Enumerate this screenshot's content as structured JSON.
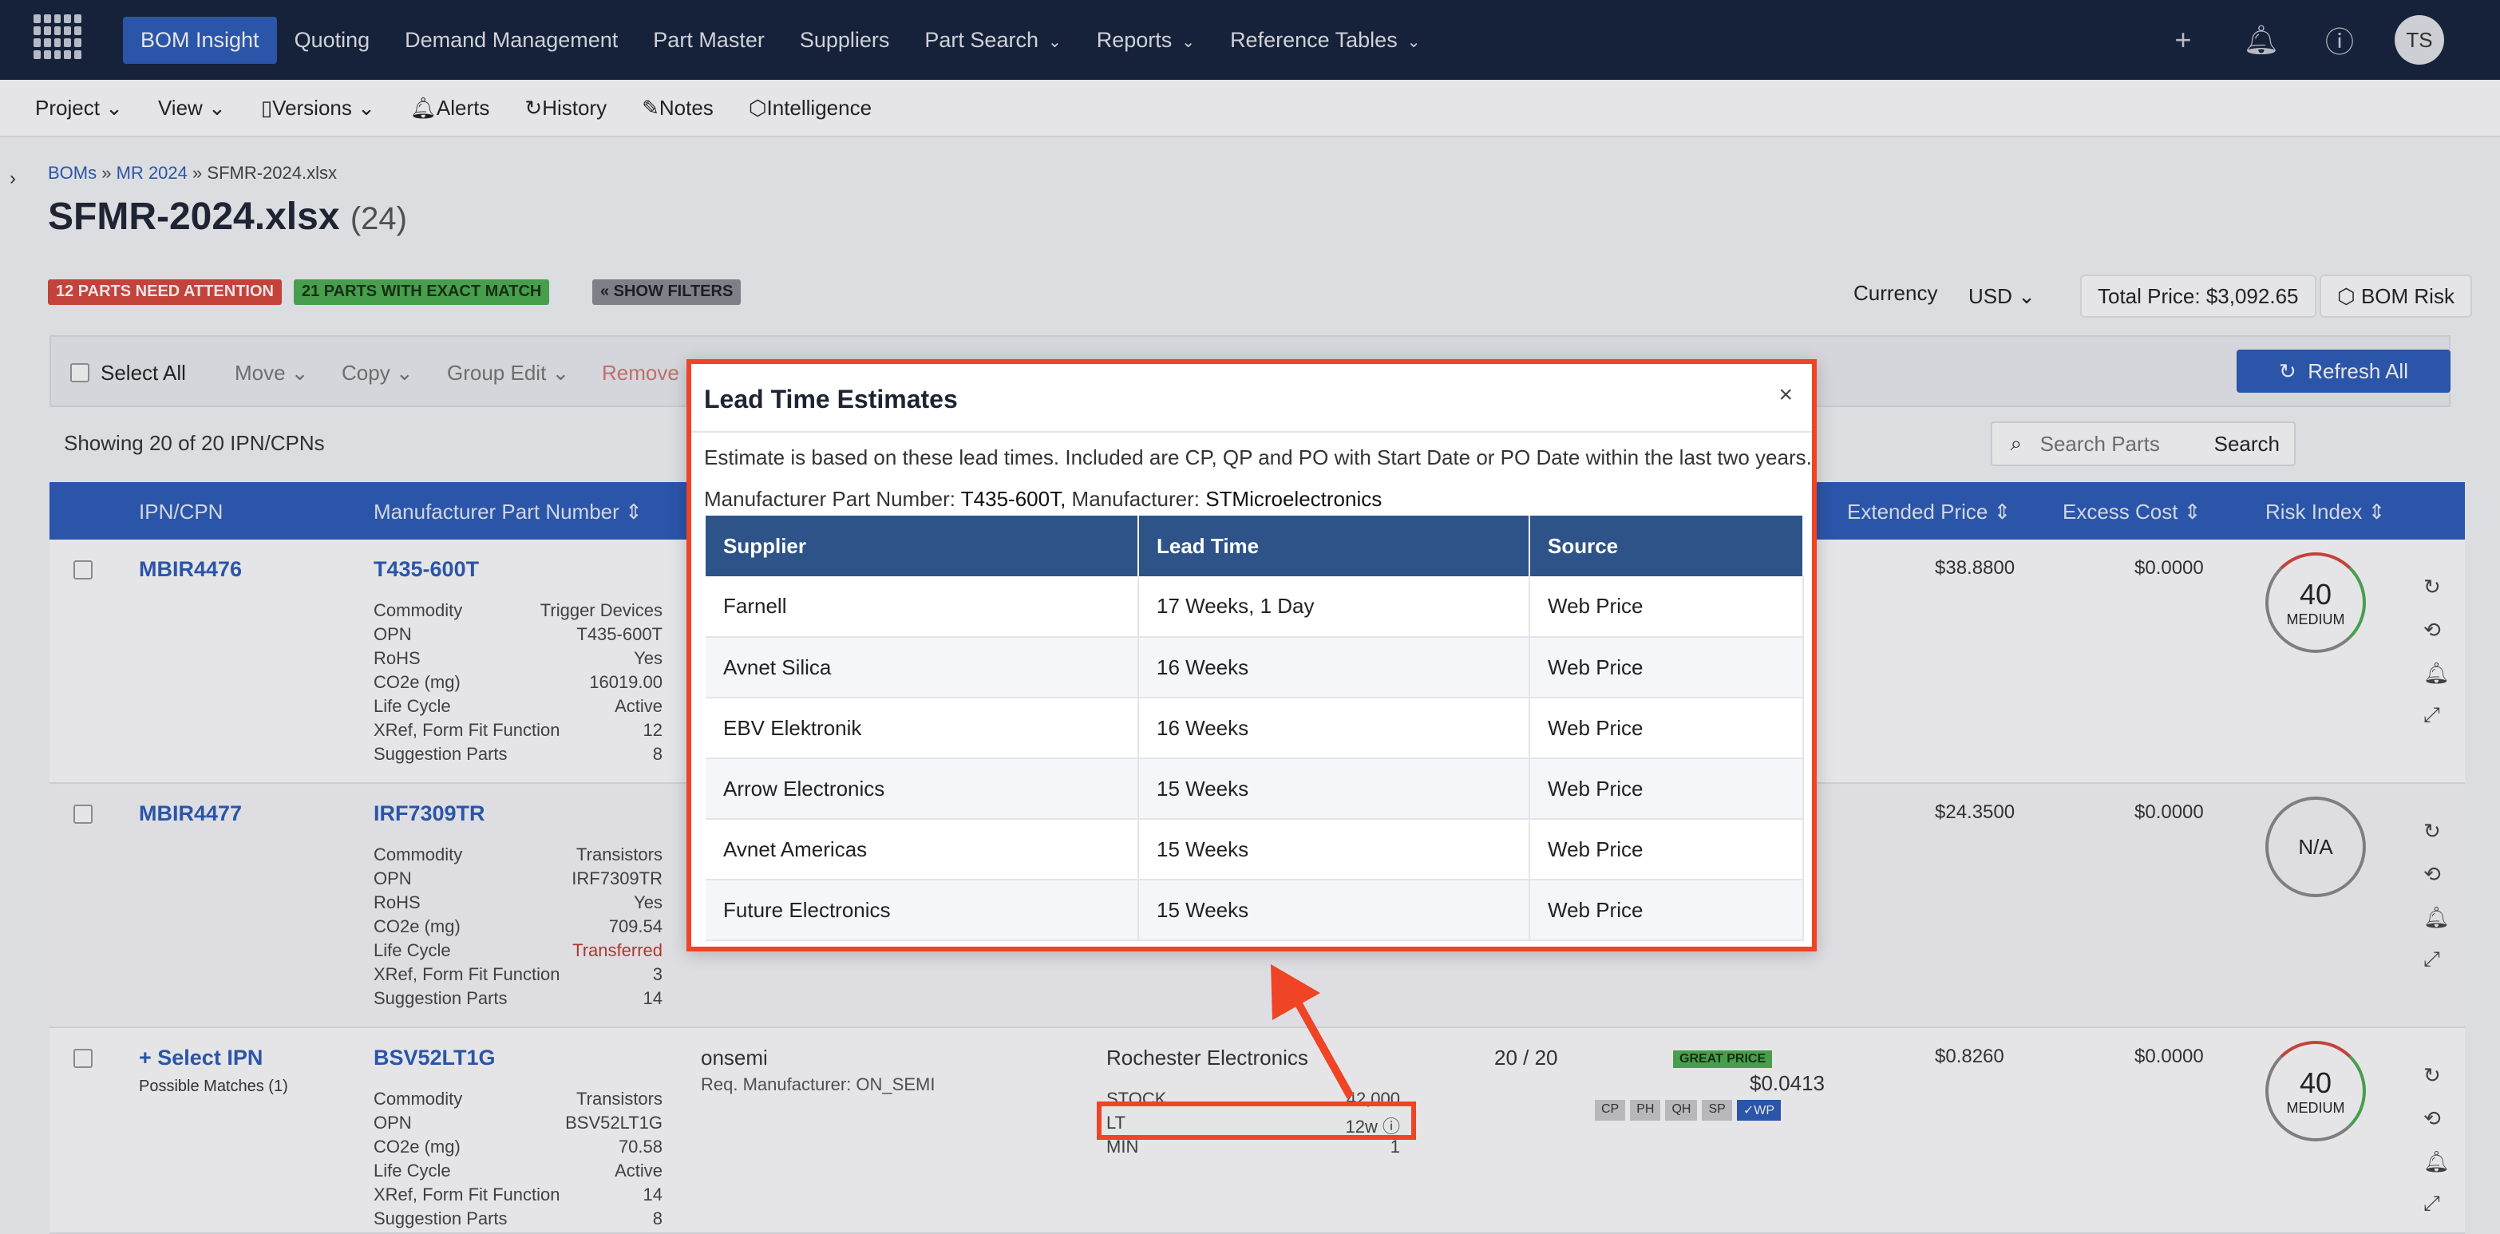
{
  "nav": {
    "items": [
      {
        "label": "BOM Insight",
        "active": true
      },
      {
        "label": "Quoting"
      },
      {
        "label": "Demand Management"
      },
      {
        "label": "Part Master"
      },
      {
        "label": "Suppliers"
      },
      {
        "label": "Part Search",
        "caret": true
      },
      {
        "label": "Reports",
        "caret": true
      },
      {
        "label": "Reference Tables",
        "caret": true
      }
    ],
    "avatar": "TS"
  },
  "subnav": {
    "project": "Project",
    "view": "View",
    "versions": "Versions",
    "alerts": "Alerts",
    "history": "History",
    "notes": "Notes",
    "intelligence": "Intelligence"
  },
  "breadcrumb": {
    "boms": "BOMs",
    "mr": "MR 2024",
    "file": "SFMR-2024.xlsx",
    "sep": "»"
  },
  "page": {
    "title": "SFMR-2024.xlsx",
    "count": "(24)"
  },
  "badges": {
    "attention": "12 PARTS NEED ATTENTION",
    "exact": "21 PARTS WITH EXACT MATCH",
    "filters": "« SHOW FILTERS"
  },
  "currency": {
    "label": "Currency",
    "value": "USD"
  },
  "total_price": "Total Price: $3,092.65",
  "bom_risk": "BOM Risk",
  "toolbar": {
    "select_all": "Select All",
    "move": "Move",
    "copy": "Copy",
    "group_edit": "Group Edit",
    "remove": "Remove",
    "refresh_all": "Refresh All"
  },
  "showing": "Showing 20 of 20 IPN/CPNs",
  "search": {
    "placeholder": "Search Parts",
    "button": "Search"
  },
  "columns": {
    "ipn": "IPN/CPN",
    "mpn": "Manufacturer Part Number",
    "ext_price": "Extended Price",
    "excess": "Excess Cost",
    "risk": "Risk Index"
  },
  "rows": [
    {
      "ipn": "MBIR4476",
      "mpn": "T435-600T",
      "commodity_label": "Commodity",
      "commodity": "Trigger Devices",
      "opn_label": "OPN",
      "opn": "T435-600T",
      "rohs_label": "RoHS",
      "rohs": "Yes",
      "co2_label": "CO2e (mg)",
      "co2": "16019.00",
      "lc_label": "Life Cycle",
      "lc": "Active",
      "xref_label": "XRef, Form Fit Function",
      "xref": "12",
      "sugg_label": "Suggestion Parts",
      "sugg": "8",
      "ext": "$38.8800",
      "excess": "$0.0000",
      "risk": "40",
      "risk_level": "MEDIUM"
    },
    {
      "ipn": "MBIR4477",
      "mpn": "IRF7309TR",
      "commodity_label": "Commodity",
      "commodity": "Transistors",
      "opn_label": "OPN",
      "opn": "IRF7309TR",
      "rohs_label": "RoHS",
      "rohs": "Yes",
      "co2_label": "CO2e (mg)",
      "co2": "709.54",
      "lc_label": "Life Cycle",
      "lc": "Transferred",
      "xref_label": "XRef, Form Fit Function",
      "xref": "3",
      "sugg_label": "Suggestion Parts",
      "sugg": "14",
      "ext": "$24.3500",
      "excess": "$0.0000",
      "risk": "N/A"
    },
    {
      "ipn": "+ Select IPN",
      "possible": "Possible Matches (1)",
      "mpn": "BSV52LT1G",
      "commodity_label": "Commodity",
      "commodity": "Transistors",
      "opn_label": "OPN",
      "opn": "BSV52LT1G",
      "co2_label": "CO2e (mg)",
      "co2": "70.58",
      "lc_label": "Life Cycle",
      "lc": "Active",
      "xref_label": "XRef, Form Fit Function",
      "xref": "14",
      "sugg_label": "Suggestion Parts",
      "sugg": "8",
      "manufacturer": "onsemi",
      "req_mfr": "Req. Manufacturer: ON_SEMI",
      "supplier": "Rochester Electronics",
      "stock_label": "STOCK",
      "stock": "42,000",
      "lt_label": "LT",
      "lt": "12w",
      "min_label": "MIN",
      "min": "1",
      "qty": "20 / 20",
      "price_badge": "GREAT PRICE",
      "unit_price": "$0.0413",
      "chips": [
        "CP",
        "PH",
        "QH",
        "SP",
        "✓WP"
      ],
      "ext": "$0.8260",
      "excess": "$0.0000",
      "risk": "40",
      "risk_level": "MEDIUM"
    }
  ],
  "modal": {
    "title": "Lead Time Estimates",
    "close": "×",
    "description": "Estimate is based on these lead times. Included are CP, QP and PO with Start Date or PO Date within the last two years.",
    "mpn_label": "Manufacturer Part Number:",
    "mpn": "T435-600T,",
    "mfr_label": "Manufacturer:",
    "mfr": "STMicroelectronics",
    "headers": [
      "Supplier",
      "Lead Time",
      "Source"
    ],
    "rows": [
      [
        "Farnell",
        "17 Weeks, 1 Day",
        "Web Price"
      ],
      [
        "Avnet Silica",
        "16 Weeks",
        "Web Price"
      ],
      [
        "EBV Elektronik",
        "16 Weeks",
        "Web Price"
      ],
      [
        "Arrow Electronics",
        "15 Weeks",
        "Web Price"
      ],
      [
        "Avnet Americas",
        "15 Weeks",
        "Web Price"
      ],
      [
        "Future Electronics",
        "15 Weeks",
        "Web Price"
      ]
    ]
  },
  "colors": {
    "nav": "#14213a",
    "accent": "#2b5cb8",
    "highlight": "#ef4426",
    "danger": "#d9463b",
    "success": "#4caf50"
  }
}
